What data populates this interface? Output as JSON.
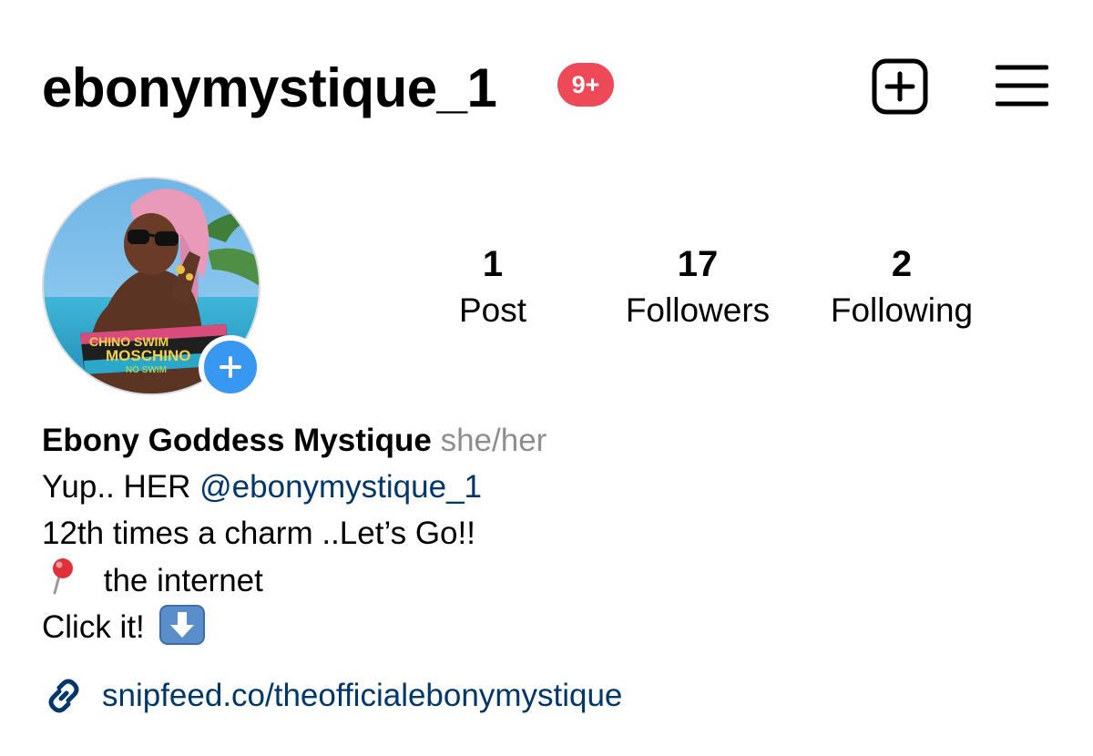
{
  "header": {
    "username": "ebonymystique_1",
    "notification_badge": "9+",
    "badge_color": "#ed4956"
  },
  "icons": {
    "create": "plus-square-icon",
    "menu": "hamburger-menu-icon",
    "add_story": "plus-circle-icon",
    "link": "link-icon",
    "location": "round-pushpin-emoji",
    "arrow": "down-arrow-emoji"
  },
  "stats": [
    {
      "number": "1",
      "label": "Post"
    },
    {
      "number": "17",
      "label": "Followers"
    },
    {
      "number": "2",
      "label": "Following"
    }
  ],
  "bio": {
    "name": "Ebony Goddess Mystique",
    "pronouns": "she/her",
    "line1_prefix": "Yup.. HER ",
    "line1_mention": "@ebonymystique_1",
    "line2": "12th times a charm ..Let’s Go!!",
    "line3_text": "the internet",
    "line4_text": "Click it!"
  },
  "link": {
    "text": "snipfeed.co/theofficialebonymystique",
    "color": "#00376b"
  },
  "avatar": {
    "swimsuit_text_1": "CHINO SWIM",
    "swimsuit_text_2": "MOSCHINO",
    "swimsuit_text_3": "NO SWIM"
  },
  "colors": {
    "add_story_blue": "#3897f0",
    "link_blue": "#00376b",
    "secondary_gray": "#8e8e8e"
  }
}
